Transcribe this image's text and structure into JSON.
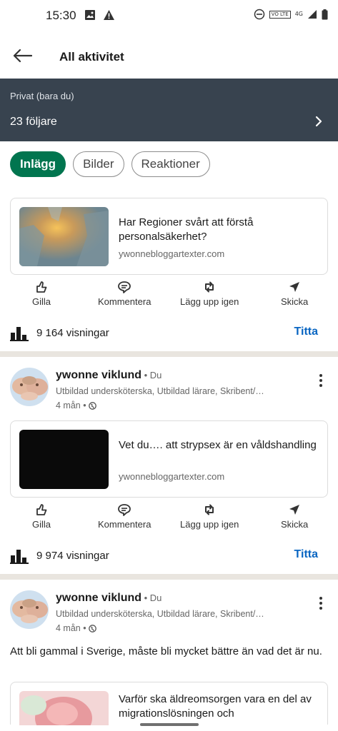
{
  "status_bar": {
    "time": "15:30",
    "network": "4G",
    "volte": "VO LTE"
  },
  "header": {
    "title": "All aktivitet"
  },
  "privacy": {
    "subtitle": "Privat (bara du)",
    "followers": "23 följare"
  },
  "tabs": [
    {
      "label": "Inlägg",
      "active": true
    },
    {
      "label": "Bilder",
      "active": false
    },
    {
      "label": "Reaktioner",
      "active": false
    }
  ],
  "actions": {
    "like": "Gilla",
    "comment": "Kommentera",
    "repost": "Lägg upp igen",
    "send": "Skicka"
  },
  "posts": [
    {
      "link_title": "Har Regioner svårt att förstå personalsäkerhet?",
      "link_domain": "ywonnebloggartexter.com",
      "views": "9 164 visningar",
      "view_button": "Titta"
    },
    {
      "author": "ywonne viklund",
      "you": " • Du",
      "headline": "Utbildad undersköterska, Utbildad lärare, Skribent/…",
      "time": "4 mån •",
      "link_title": "Vet du…. att strypsex är en våldshandling",
      "link_domain": "ywonnebloggartexter.com",
      "views": "9 974 visningar",
      "view_button": "Titta"
    },
    {
      "author": "ywonne viklund",
      "you": " • Du",
      "headline": "Utbildad undersköterska, Utbildad lärare, Skribent/…",
      "time": "4 mån •",
      "text": "Att bli gammal i Sverige, måste bli mycket bättre än vad det är nu.",
      "link_title": "Varför ska äldreomsorgen vara en del av migrationslösningen och"
    }
  ],
  "colors": {
    "brand_green": "#01754f",
    "link_blue": "#0a66c2",
    "banner_bg": "#38434f"
  }
}
